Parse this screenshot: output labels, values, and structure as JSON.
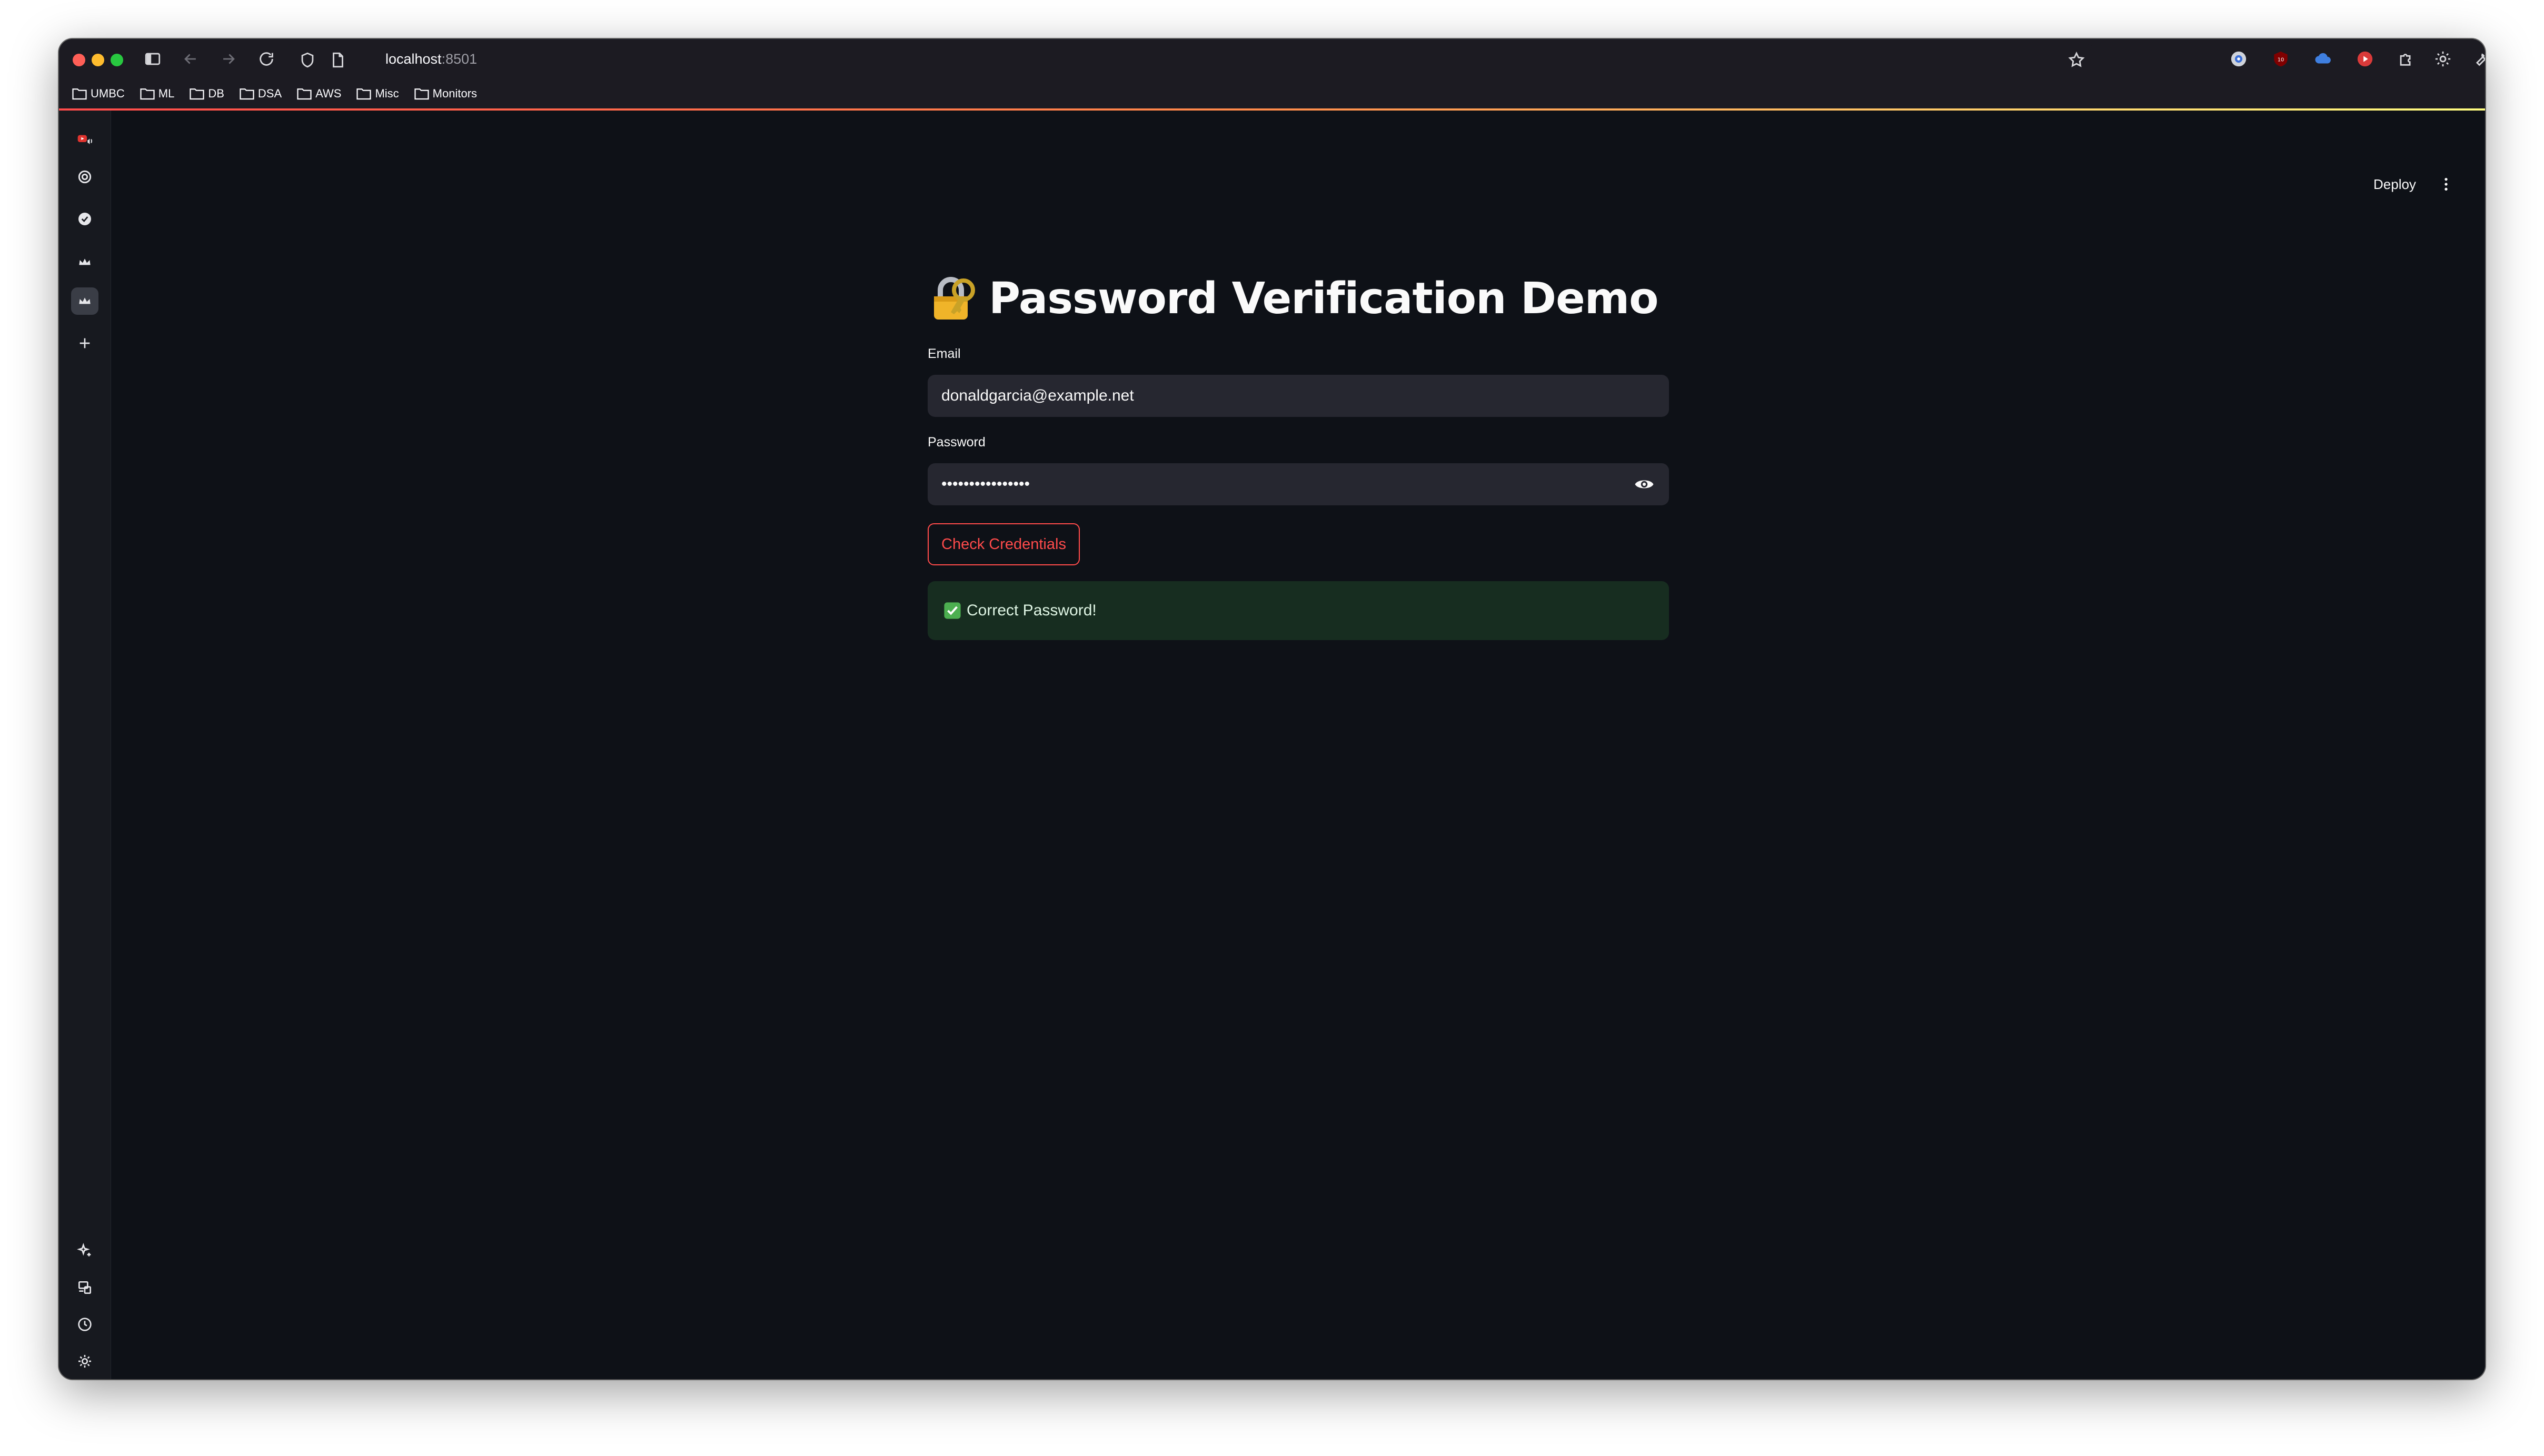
{
  "browser": {
    "url_host": "localhost",
    "url_port": ":8501",
    "bookmarks": [
      "UMBC",
      "ML",
      "DB",
      "DSA",
      "AWS",
      "Misc",
      "Monitors"
    ]
  },
  "app": {
    "deploy_label": "Deploy",
    "title": "Password Verification Demo",
    "title_icon": "locked-with-key-icon",
    "email": {
      "label": "Email",
      "value": "donaldgarcia@example.net"
    },
    "password": {
      "label": "Password",
      "masked_value": "••••••••••••••••"
    },
    "check_button_label": "Check Credentials",
    "alert": {
      "text": "Correct Password!",
      "icon": "green-checkmark-icon"
    }
  },
  "colors": {
    "accent": "#ff4b4b",
    "background": "#0e1117",
    "success_bg": "#172d20"
  }
}
